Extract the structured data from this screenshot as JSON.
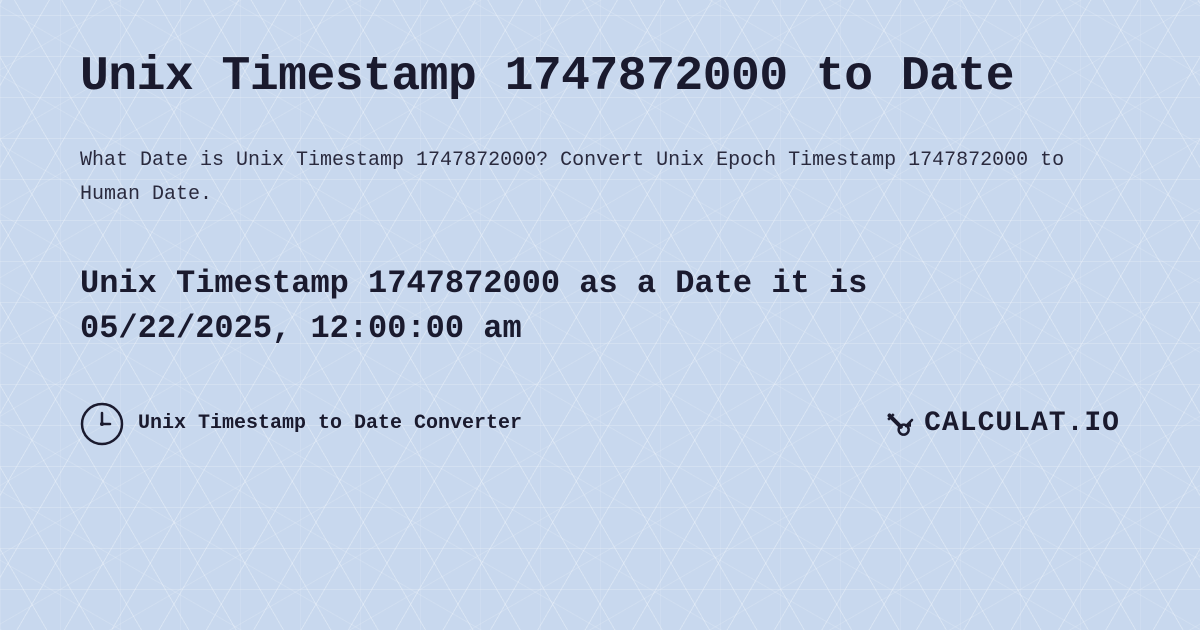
{
  "page": {
    "title": "Unix Timestamp 1747872000 to Date",
    "description": "What Date is Unix Timestamp 1747872000? Convert Unix Epoch Timestamp 1747872000 to Human Date.",
    "result_line1": "Unix Timestamp 1747872000 as a Date it is",
    "result_line2": "05/22/2025, 12:00:00 am",
    "footer_label": "Unix Timestamp to Date Converter",
    "logo_text": "CALCULAT.IO",
    "background_color": "#c8d8ee"
  }
}
